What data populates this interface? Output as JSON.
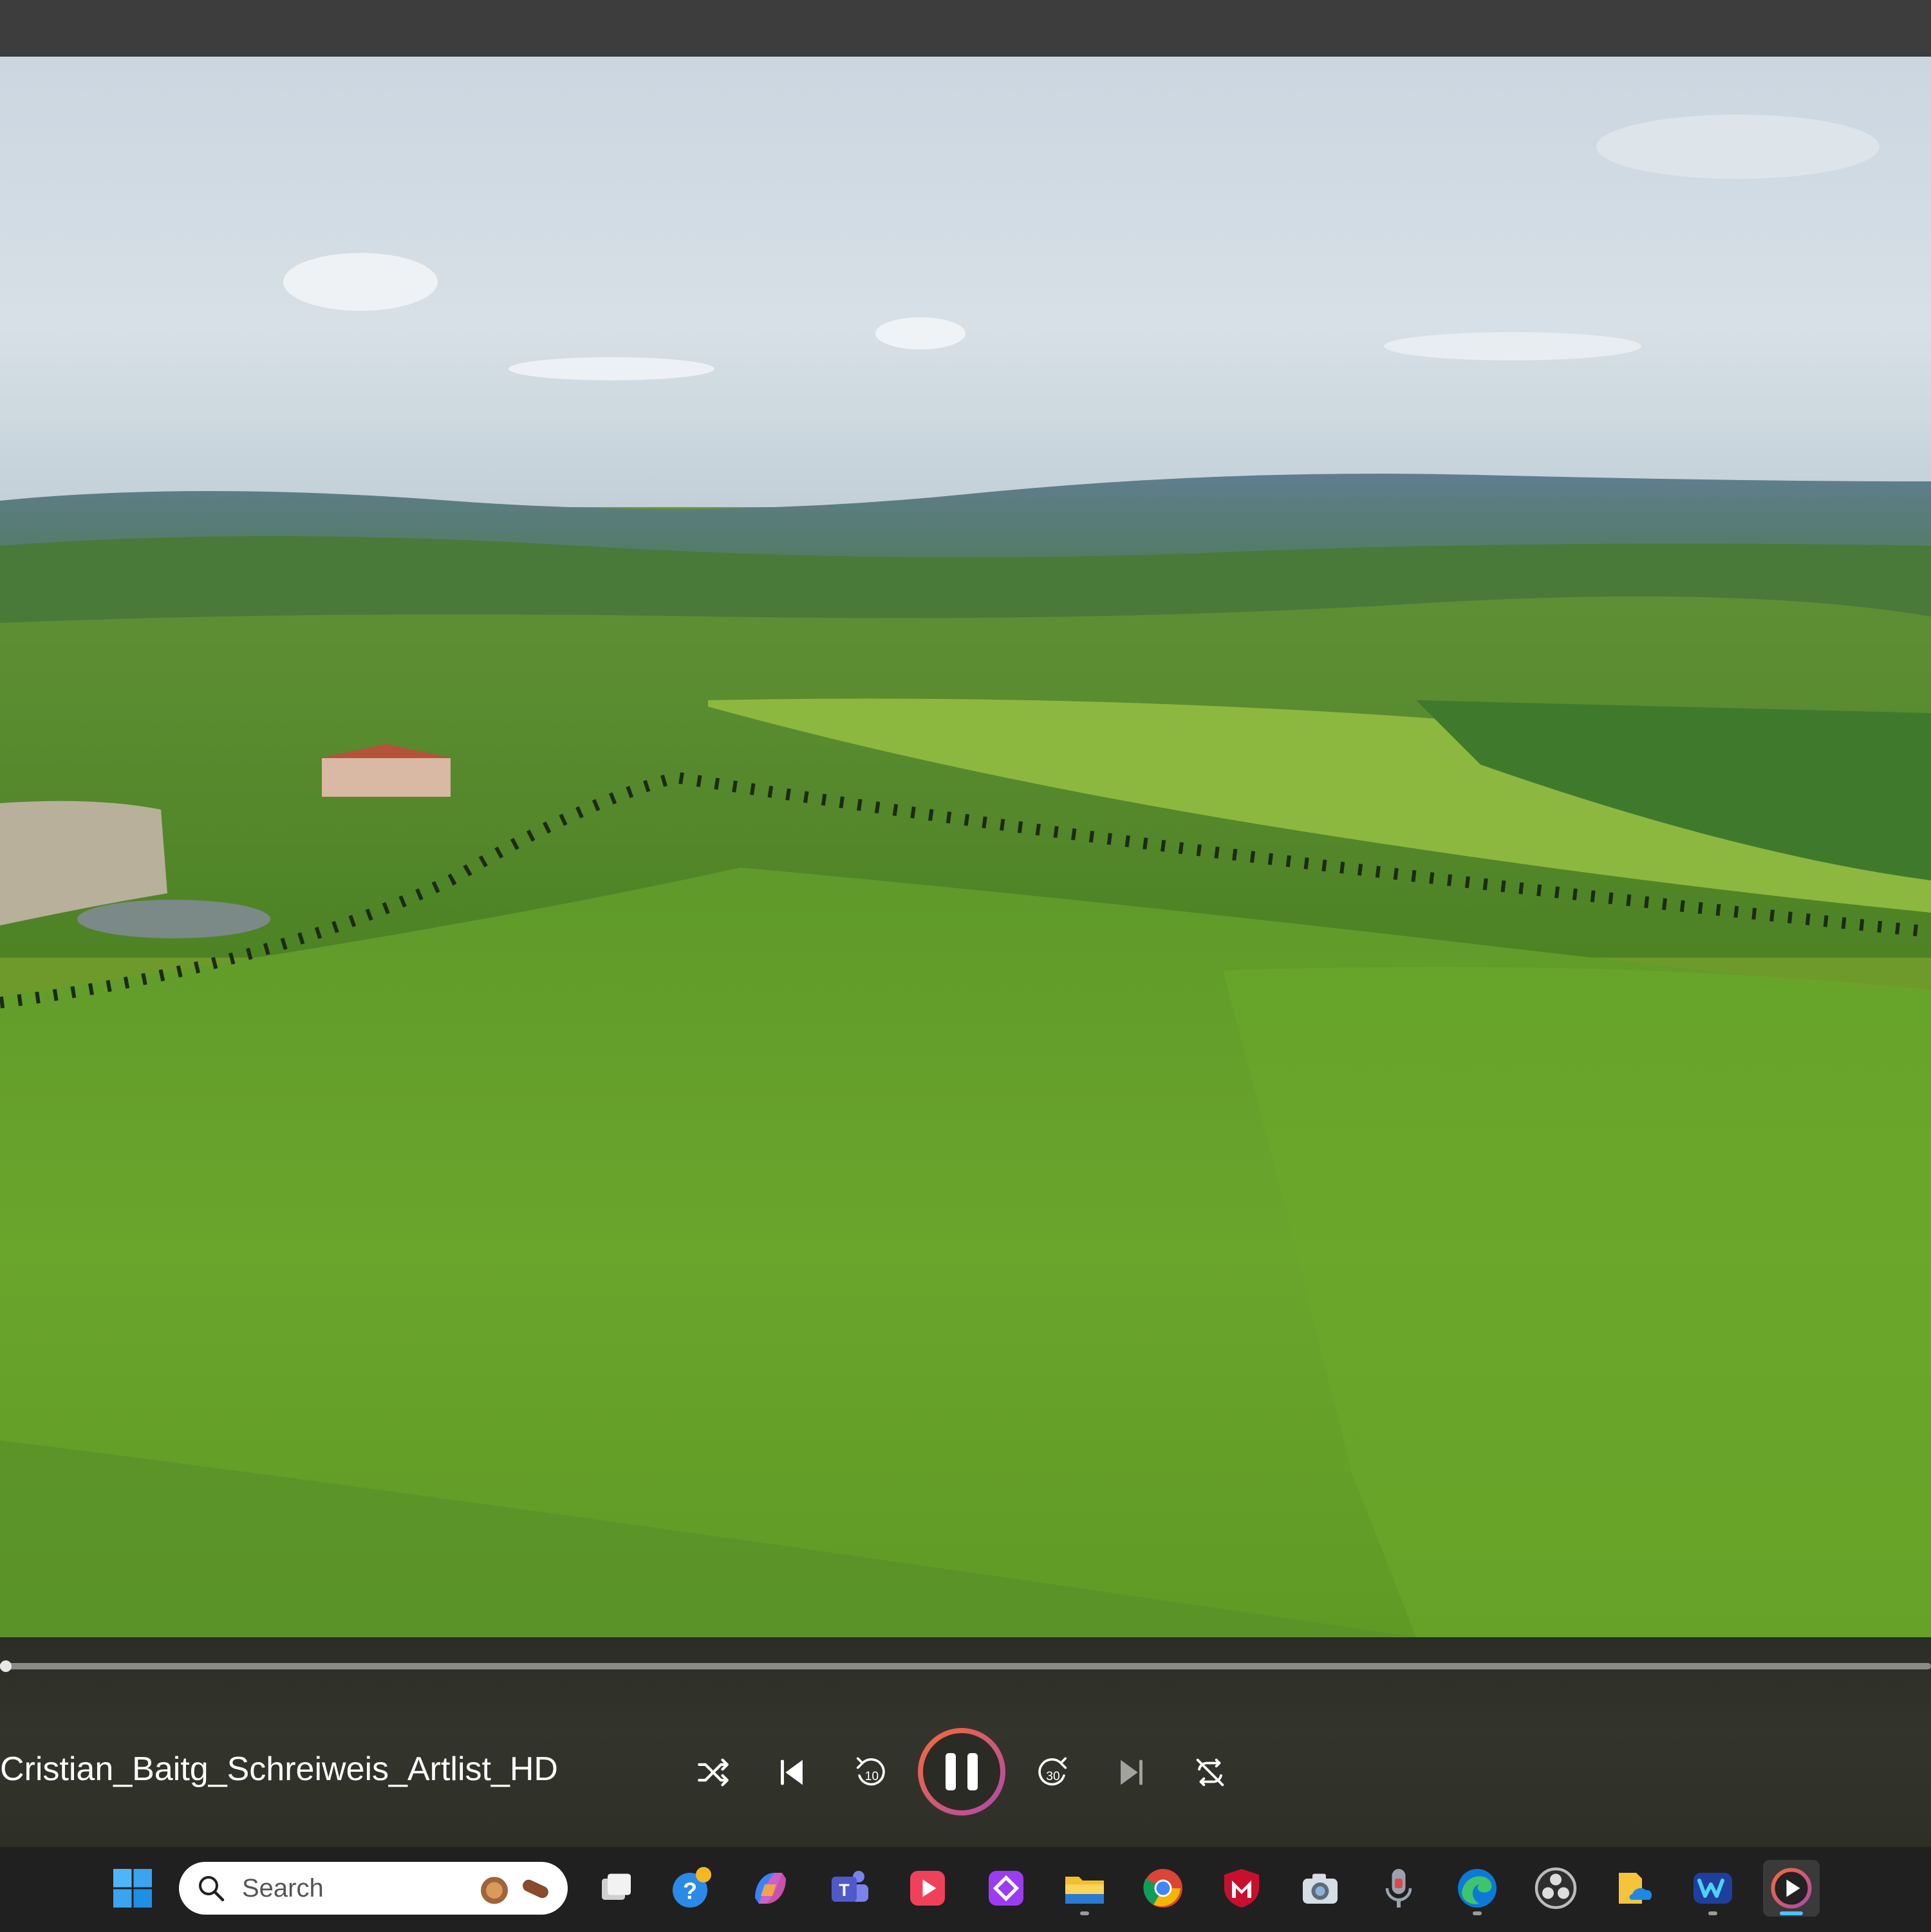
{
  "player": {
    "media_title": "Cristian_Baitg_Schreiweis_Artlist_HD",
    "progress": 0.002,
    "state": "playing",
    "controls": [
      "shuffle-icon",
      "previous-icon",
      "rewind-10-icon",
      "pause-icon",
      "forward-30-icon",
      "next-icon",
      "repeat-off-icon"
    ],
    "rewind_label": "10",
    "forward_label": "30",
    "accent_gradient": [
      "#f26b3a",
      "#b04aa8"
    ]
  },
  "taskbar": {
    "search_placeholder": "Search",
    "apps": [
      "start-icon",
      "search-box",
      "task-view-icon",
      "get-help-icon",
      "copilot-icon",
      "teams-icon",
      "video-player-icon",
      "dev-app-icon",
      "file-explorer-icon",
      "chrome-icon",
      "mcafee-icon",
      "camera-icon",
      "voice-recorder-icon",
      "edge-icon",
      "obs-icon",
      "onedrive-files-icon",
      "app-icon",
      "media-player-icon"
    ],
    "active_app": "media-player-icon"
  }
}
